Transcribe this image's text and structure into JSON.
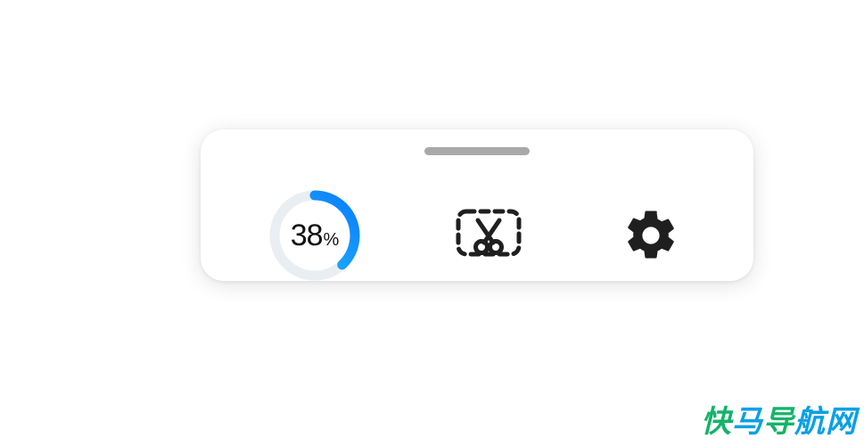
{
  "panel": {
    "progress": {
      "value": 38,
      "value_display": "38",
      "percent_symbol": "%"
    },
    "items": {
      "screenshot_label": "Screenshot",
      "settings_label": "Settings"
    }
  },
  "watermark": {
    "text": "快马导航网",
    "ch1": "快",
    "ch2": "马",
    "ch3": "导",
    "ch4": "航",
    "ch5": "网"
  },
  "colors": {
    "ring_track": "#e9eef2",
    "ring_gradient_start": "#0a7cff",
    "ring_gradient_end": "#26c5f3",
    "handle": "#a9a9a9",
    "icon": "#1f1f1f"
  }
}
